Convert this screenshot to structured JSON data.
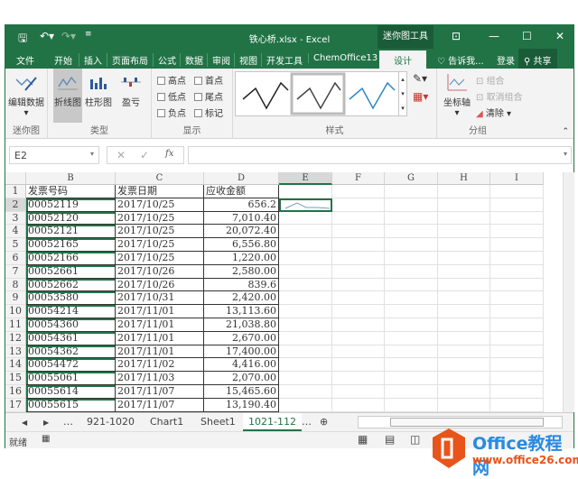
{
  "title": "铁心桥.xlsx - Excel",
  "context_tab": "迷你图工具",
  "tabs": [
    "文件",
    "开始",
    "插入",
    "页面布局",
    "公式",
    "数据",
    "审阅",
    "视图",
    "开发工具",
    "ChemOffice13",
    "设计"
  ],
  "tell_me": "告诉我...",
  "login": "登录",
  "share": "共享",
  "ribbon": {
    "edit_data": "编辑数据",
    "group_sparkline": "迷你图",
    "type_line": "折线图",
    "type_column": "柱形图",
    "type_winloss": "盈亏",
    "group_type": "类型",
    "show": [
      "高点",
      "首点",
      "低点",
      "尾点",
      "负点",
      "标记"
    ],
    "group_show": "显示",
    "group_style": "样式",
    "axis": "坐标轴",
    "group_btn": "组合",
    "ungroup_btn": "取消组合",
    "clear_btn": "清除",
    "group_group": "分组"
  },
  "namebox": "E2",
  "fx": "fx",
  "columns": [
    "B",
    "C",
    "D",
    "E",
    "F",
    "G",
    "H",
    "I"
  ],
  "rows": [
    [
      "发票号码",
      "发票日期",
      "应收金额"
    ],
    [
      "00052119",
      "2017/10/25",
      "656.2"
    ],
    [
      "00052120",
      "2017/10/25",
      "7,010.40"
    ],
    [
      "00052121",
      "2017/10/25",
      "20,072.40"
    ],
    [
      "00052165",
      "2017/10/25",
      "6,556.80"
    ],
    [
      "00052166",
      "2017/10/25",
      "1,220.00"
    ],
    [
      "00052661",
      "2017/10/26",
      "2,580.00"
    ],
    [
      "00052662",
      "2017/10/26",
      "839.6"
    ],
    [
      "00053580",
      "2017/10/31",
      "2,420.00"
    ],
    [
      "00054214",
      "2017/11/01",
      "13,113.60"
    ],
    [
      "00054360",
      "2017/11/01",
      "21,038.80"
    ],
    [
      "00054361",
      "2017/11/01",
      "2,670.00"
    ],
    [
      "00054362",
      "2017/11/01",
      "17,400.00"
    ],
    [
      "00054472",
      "2017/11/02",
      "4,416.00"
    ],
    [
      "00055061",
      "2017/11/03",
      "2,070.00"
    ],
    [
      "00055614",
      "2017/11/07",
      "15,465.60"
    ],
    [
      "00055615",
      "2017/11/07",
      "13,190.40"
    ]
  ],
  "sheet_tabs": [
    "921-1020",
    "Chart1",
    "Sheet1",
    "1021-112"
  ],
  "status": "就绪",
  "watermark": {
    "name": "Office教程网",
    "url": "www.office26.com"
  },
  "colors": {
    "accent": "#217346",
    "logo": "#e8541a"
  }
}
